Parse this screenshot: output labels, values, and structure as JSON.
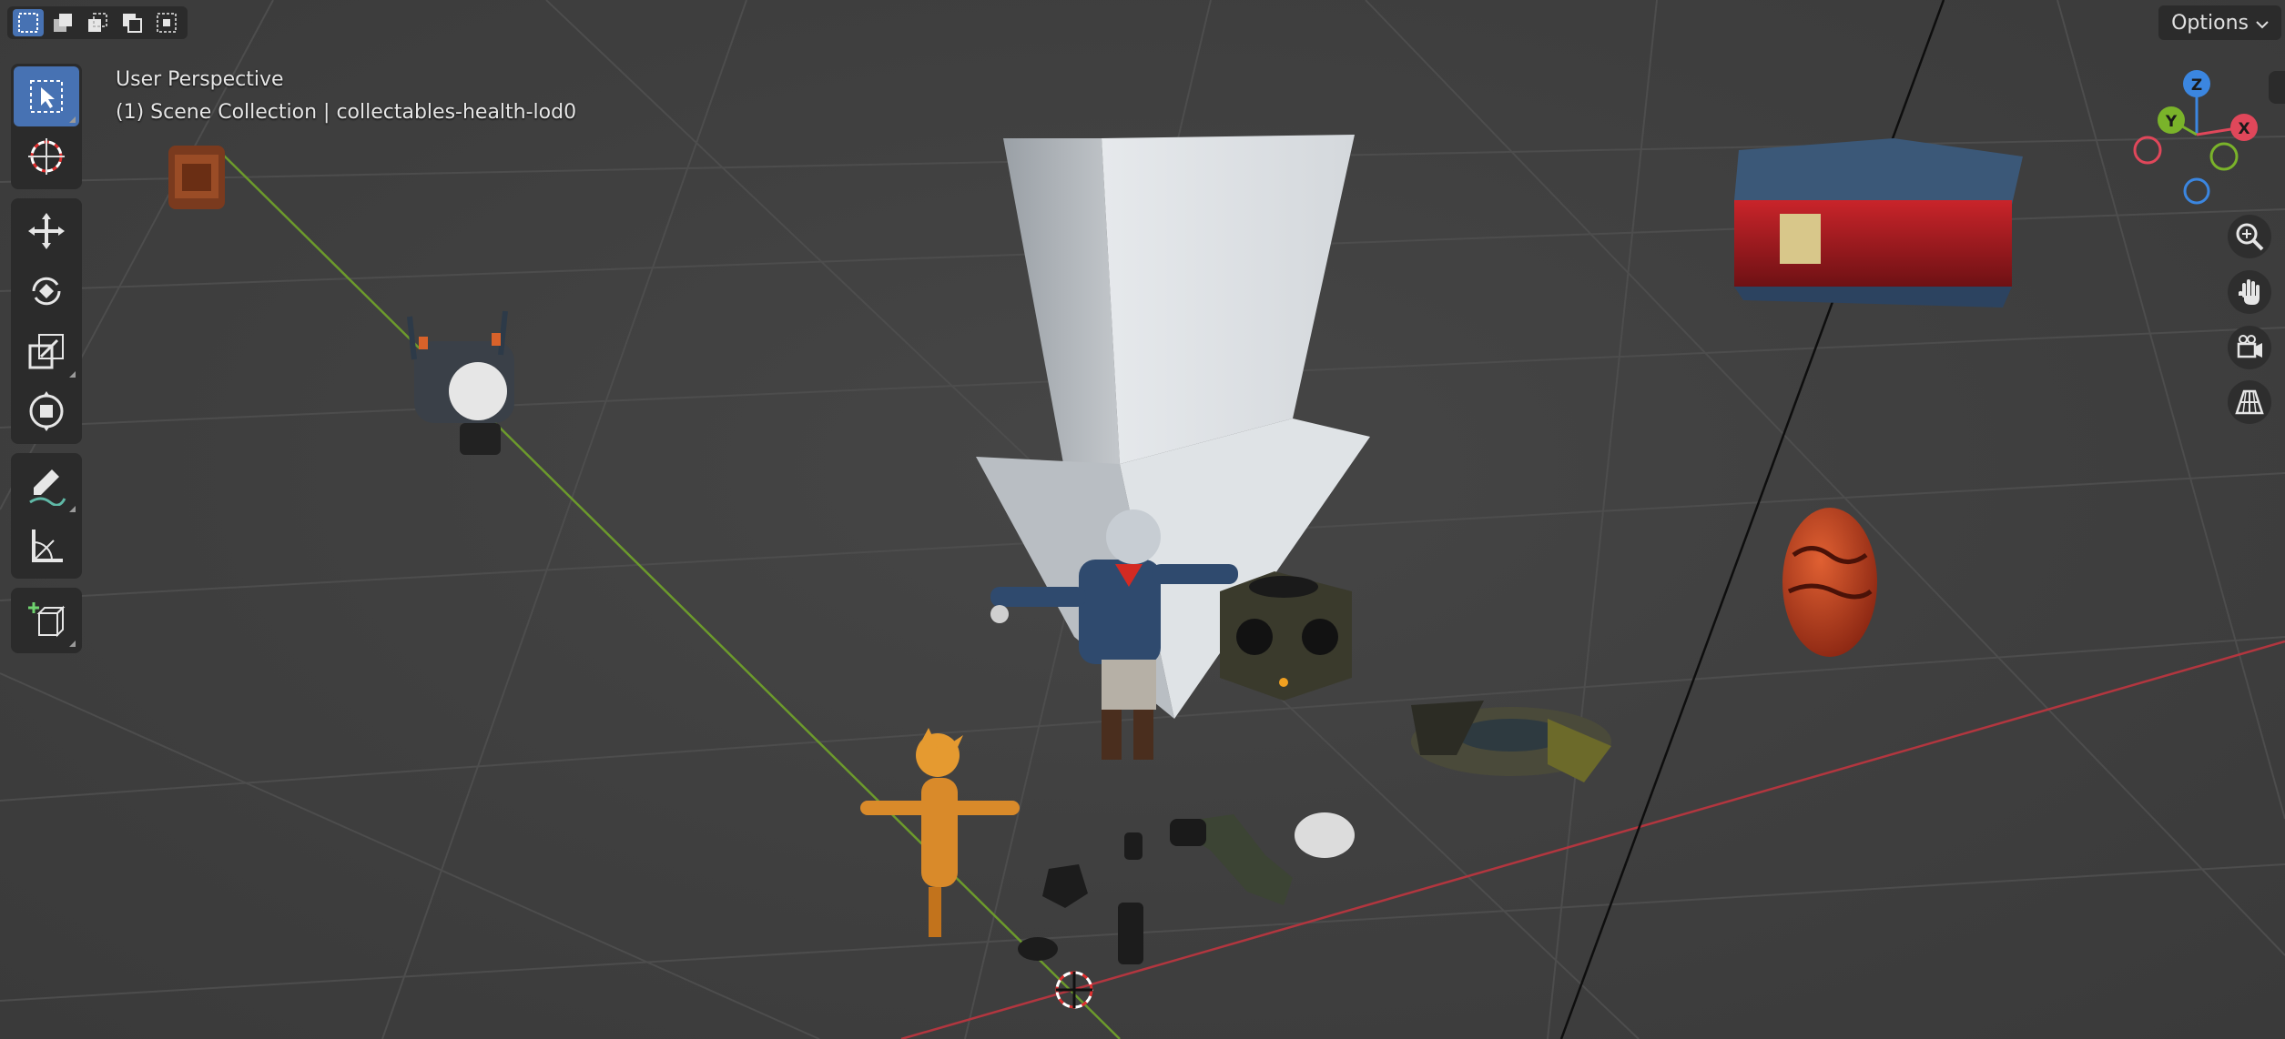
{
  "header": {
    "options_label": "Options",
    "select_modes": [
      "select-new-icon",
      "select-extend-icon",
      "select-subtract-icon",
      "select-invert-icon",
      "select-intersect-icon"
    ]
  },
  "toolbar": {
    "tools": [
      "select-box-icon",
      "cursor-icon",
      "move-icon",
      "rotate-icon",
      "scale-icon",
      "transform-icon",
      "annotate-icon",
      "measure-icon",
      "add-cube-icon"
    ],
    "active_tool": "select-box-icon"
  },
  "viewport": {
    "perspective_label": "User Perspective",
    "collection_label": "(1) Scene Collection | collectables-health-lod0"
  },
  "gizmo": {
    "axes": [
      "Z",
      "Y",
      "X"
    ],
    "colors": {
      "x": "#e0475a",
      "y": "#7ab32a",
      "z": "#3b86e0"
    }
  },
  "nav_buttons": [
    "zoom-icon",
    "pan-hand-icon",
    "camera-icon",
    "grid-view-icon"
  ],
  "colors": {
    "accent": "#4772b3",
    "background": "#3d3d3d",
    "panel": "#2b2b2b",
    "x_axis": "#b2363f",
    "y_axis": "#6c9a2c"
  }
}
